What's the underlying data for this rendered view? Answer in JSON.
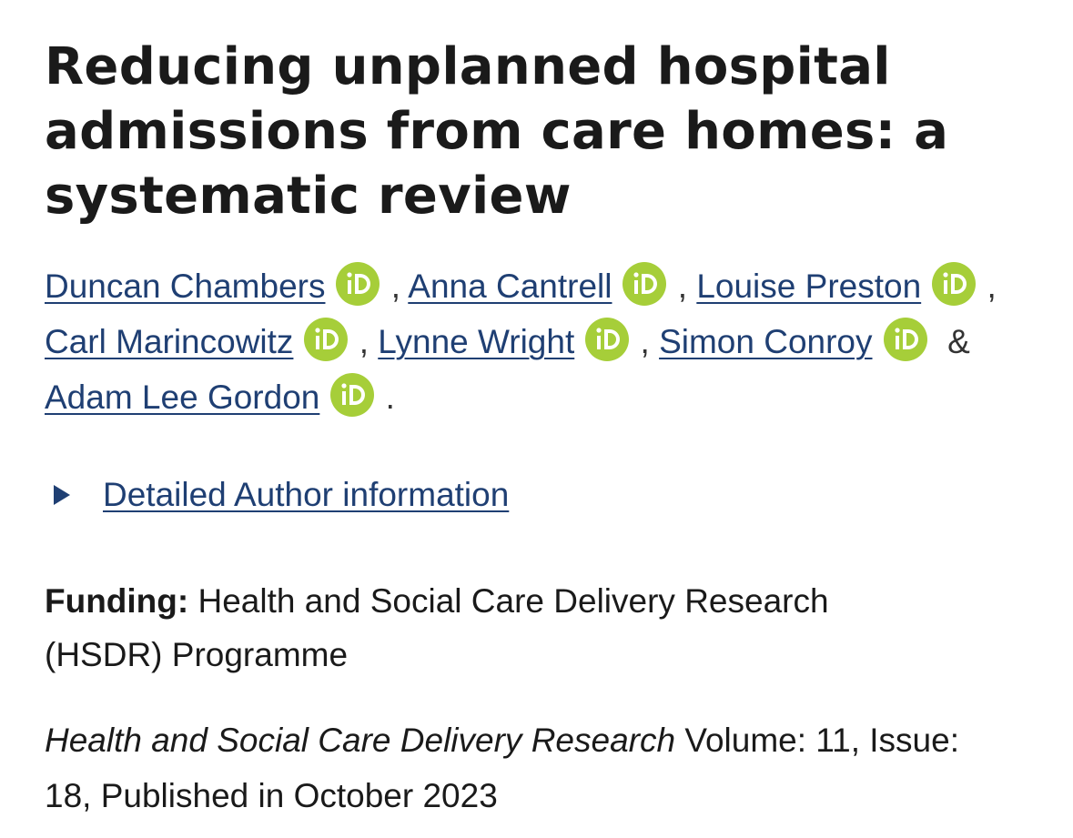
{
  "article": {
    "title": "Reducing unplanned hospital admissions from care homes: a systematic review"
  },
  "authors": [
    {
      "name": "Duncan Chambers",
      "icon": "orcid-icon"
    },
    {
      "name": "Anna Cantrell",
      "icon": "orcid-icon"
    },
    {
      "name": "Louise Preston",
      "icon": "orcid-icon"
    },
    {
      "name": "Carl Marincowitz",
      "icon": "orcid-icon"
    },
    {
      "name": "Lynne Wright",
      "icon": "orcid-icon"
    },
    {
      "name": "Simon Conroy",
      "icon": "orcid-icon"
    },
    {
      "name": "Adam Lee Gordon",
      "icon": "orcid-icon"
    }
  ],
  "separators": {
    "comma": ",",
    "ampersand": "&",
    "period": "."
  },
  "details": {
    "label": "Detailed Author information",
    "icon": "disclosure-triangle-icon"
  },
  "funding": {
    "label": "Funding:",
    "value": "Health and Social Care Delivery Research (HSDR) Programme"
  },
  "journal": {
    "name": "Health and Social Care Delivery Research",
    "info": "Volume: 11, Issue: 18, Published in October 2023"
  },
  "colors": {
    "link": "#1f3f73",
    "orcid": "#a6ce39",
    "text": "#1a1a1a"
  }
}
